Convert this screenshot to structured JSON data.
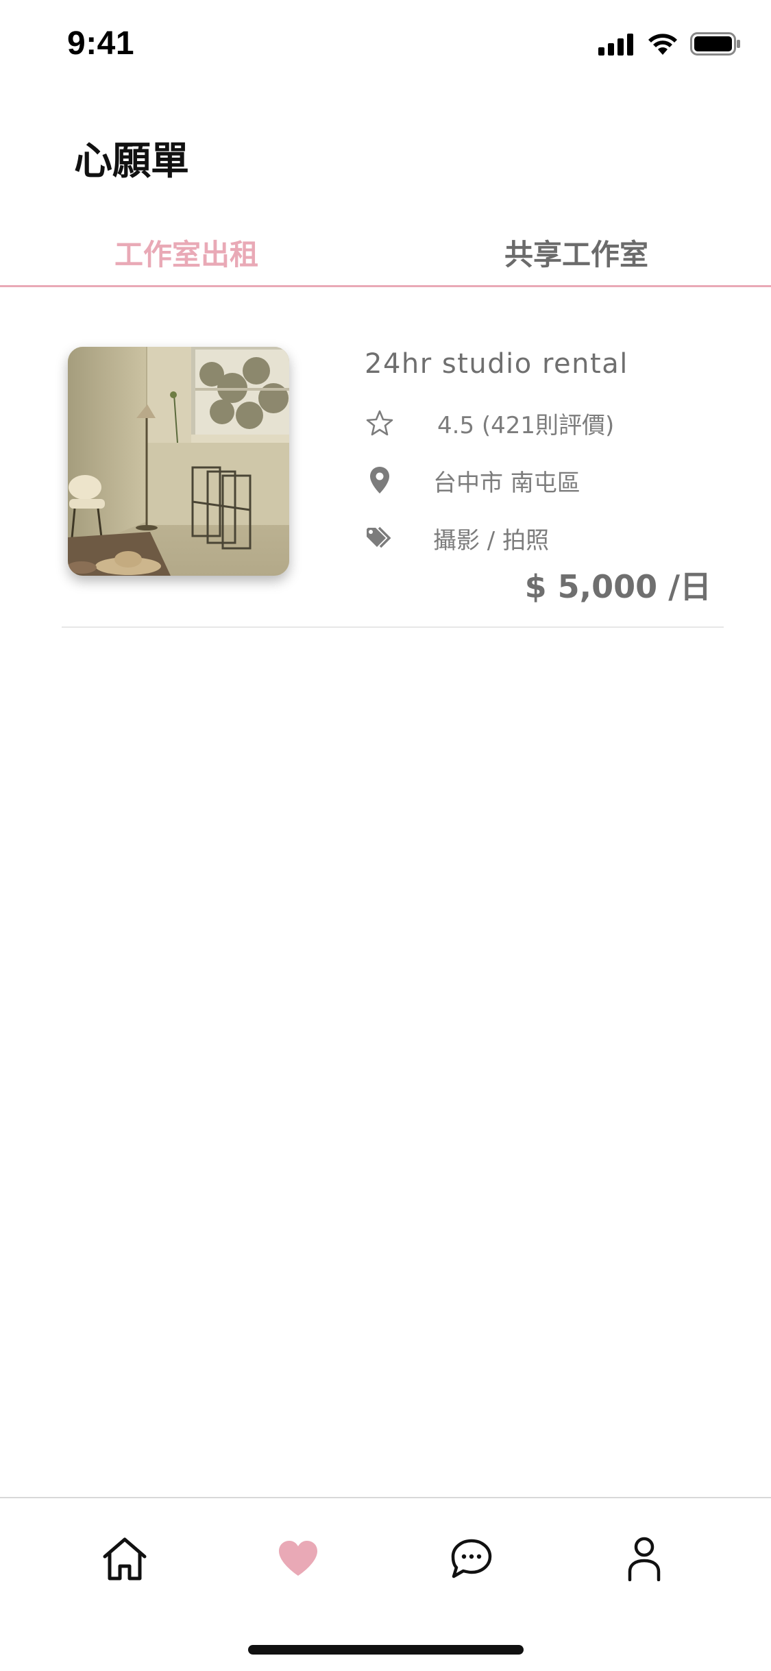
{
  "status_bar": {
    "time": "9:41"
  },
  "page": {
    "title": "心願單"
  },
  "tabs": [
    {
      "label": "工作室出租",
      "active": true
    },
    {
      "label": "共享工作室",
      "active": false
    }
  ],
  "colors": {
    "accent": "#e9a9b6",
    "text_muted": "#7c7c7c"
  },
  "listing": {
    "title": "24hr studio rental",
    "rating_text": "4.5 (421則評價)",
    "location": "台中市 南屯區",
    "tags": "攝影 / 拍照",
    "price": "$ 5,000 /日",
    "icons": {
      "rating": "star-outline-icon",
      "location": "map-pin-icon",
      "tags": "tag-icon"
    }
  },
  "bottom_nav": [
    {
      "name": "home",
      "icon": "home-icon",
      "active": false
    },
    {
      "name": "wishlist",
      "icon": "heart-icon",
      "active": true
    },
    {
      "name": "messages",
      "icon": "chat-bubble-icon",
      "active": false
    },
    {
      "name": "profile",
      "icon": "user-icon",
      "active": false
    }
  ]
}
